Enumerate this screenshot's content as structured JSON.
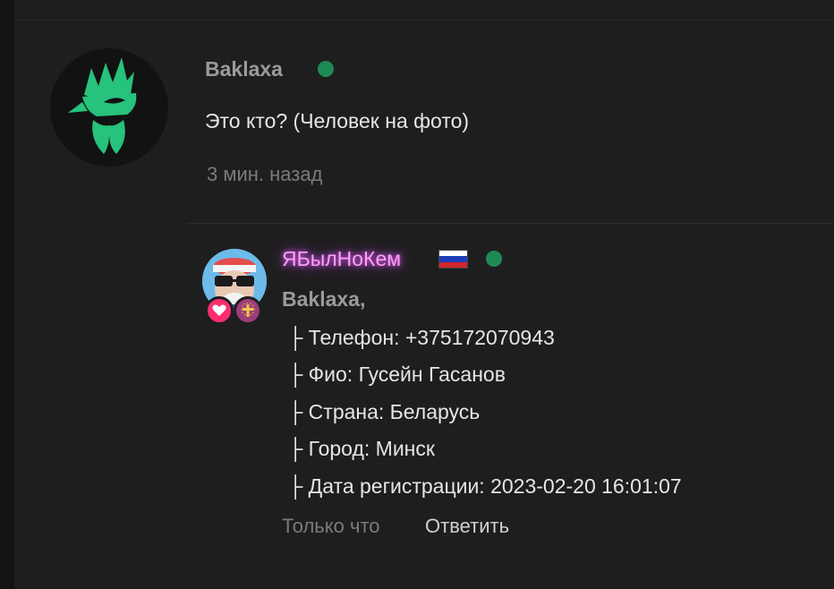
{
  "comment": {
    "username": "Baklaxa",
    "online": true,
    "text": "Это кто? (Человек на фото)",
    "time": "3 мин. назад",
    "avatar_icon": "green-rooster-logo"
  },
  "reply": {
    "username": "ЯБылНоКем",
    "flag_icon": "russia-flag",
    "online": true,
    "mention": "Baklaxa,",
    "lines": [
      "├ Телефон: +375172070943",
      "├ Фио: Гусейн Гасанов",
      "├ Страна: Беларусь",
      "├ Город: Минск",
      "├ Дата регистрации: 2023-02-20 16:01:07"
    ],
    "time": "Только что",
    "reply_label": "Ответить",
    "badges": [
      "heart-badge",
      "cross-badge"
    ]
  },
  "colors": {
    "background": "#1e1e1f",
    "online": "#1e8b55",
    "accent_green": "#27c27b",
    "username_glow": "#e25cf5"
  }
}
